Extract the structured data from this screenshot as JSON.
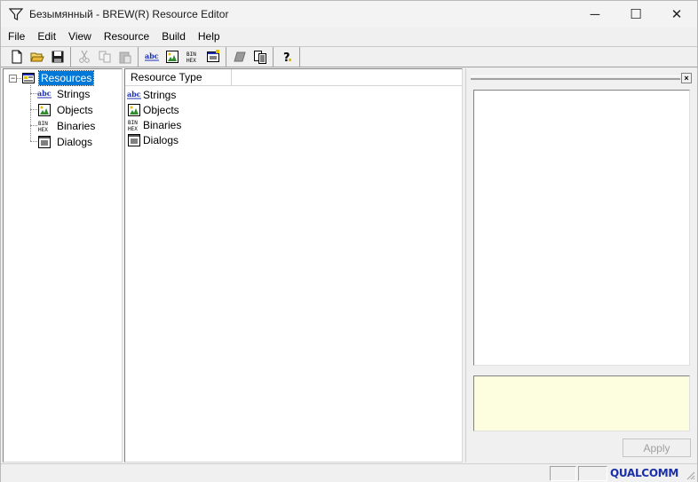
{
  "window": {
    "title": "Безымянный - BREW(R) Resource Editor",
    "minimize_glyph": "─",
    "maximize_glyph": "☐",
    "close_glyph": "✕"
  },
  "menu": [
    "File",
    "Edit",
    "View",
    "Resource",
    "Build",
    "Help"
  ],
  "toolbar": {
    "groups": [
      [
        "new-file-icon",
        "open-folder-icon",
        "save-icon"
      ],
      [
        "cut-icon",
        "copy-icon",
        "paste-icon"
      ],
      [
        "new-string-icon",
        "new-object-icon",
        "new-binary-icon",
        "new-dialog-icon"
      ],
      [
        "eraser-icon",
        "build-resource-icon"
      ],
      [
        "help-icon"
      ]
    ]
  },
  "tree": {
    "root": {
      "label": "Resources",
      "expander": "−"
    },
    "children": [
      {
        "label": "Strings",
        "icon": "strings-icon"
      },
      {
        "label": "Objects",
        "icon": "objects-icon"
      },
      {
        "label": "Binaries",
        "icon": "binaries-icon"
      },
      {
        "label": "Dialogs",
        "icon": "dialogs-icon"
      }
    ]
  },
  "list": {
    "column_header": "Resource Type",
    "rows": [
      {
        "label": "Strings",
        "icon": "strings-icon"
      },
      {
        "label": "Objects",
        "icon": "objects-icon"
      },
      {
        "label": "Binaries",
        "icon": "binaries-icon"
      },
      {
        "label": "Dialogs",
        "icon": "dialogs-icon"
      }
    ]
  },
  "right_panel": {
    "close_glyph": "×",
    "apply_label": "Apply"
  },
  "status": {
    "brand": "QUALCOMM"
  },
  "colors": {
    "selection": "#0078d7",
    "info_background": "#fdfde0",
    "brand": "#1b2fa6"
  }
}
